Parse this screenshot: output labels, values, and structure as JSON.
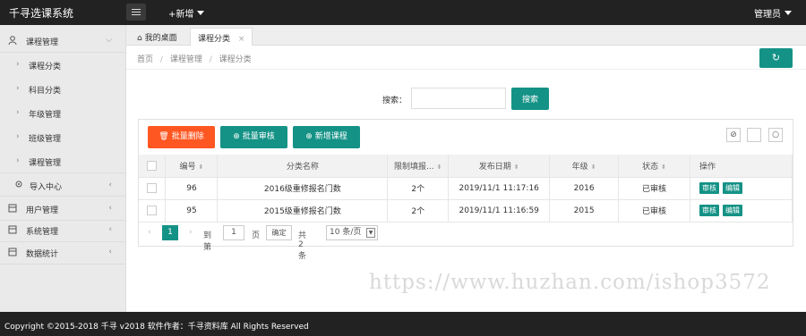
{
  "header": {
    "logo": "千寻选课系统",
    "add_new": "+新增",
    "admin": "管理员"
  },
  "sidebar": {
    "items": [
      {
        "label": "课程管理",
        "icon": "user-icon",
        "expanded": true
      },
      {
        "label": "课程分类"
      },
      {
        "label": "科目分类"
      },
      {
        "label": "年级管理"
      },
      {
        "label": "班级管理"
      },
      {
        "label": "课程管理"
      },
      {
        "label": "导入中心",
        "icon": "location-icon"
      },
      {
        "label": "用户管理",
        "icon": "document-icon"
      },
      {
        "label": "系统管理",
        "icon": "document-icon"
      },
      {
        "label": "数据统计",
        "icon": "document-icon"
      }
    ]
  },
  "tabs": {
    "home": "我的桌面",
    "active": "课程分类",
    "close": "×"
  },
  "breadcrumb": {
    "items": [
      "首页",
      "课程管理",
      "课程分类"
    ],
    "separator": "/"
  },
  "search": {
    "label": "搜索：",
    "value": "",
    "placeholder": "",
    "button": "搜索"
  },
  "toolbar": {
    "batch_delete": "批量删除",
    "batch_audit": "批量审核",
    "add_course": "新增课程"
  },
  "table": {
    "headers": [
      "编号",
      "分类名称",
      "限制填报...",
      "发布日期",
      "年级",
      "状态",
      "操作"
    ],
    "rows": [
      {
        "id": "96",
        "name": "2016级重修报名门数",
        "limit": "2个",
        "date": "2019/11/1 11:17:16",
        "grade": "2016",
        "status": "已审核",
        "op1": "审核",
        "op2": "编辑"
      },
      {
        "id": "95",
        "name": "2015级重修报名门数",
        "limit": "2个",
        "date": "2019/11/1 11:16:59",
        "grade": "2015",
        "status": "已审核",
        "op1": "审核",
        "op2": "编辑"
      }
    ]
  },
  "pager": {
    "current": "1",
    "goto": "到第",
    "input": "1",
    "page": "页",
    "confirm": "确定",
    "total": "共 2 条",
    "size": "10 条/页"
  },
  "watermark": "https://www.huzhan.com/ishop3572",
  "footer": "Copyright ©2015-2018 千寻 v2018 软件作者：千寻资料库 All Rights Reserved",
  "colors": {
    "primary": "#149286",
    "danger": "#ff5722",
    "topbar": "#222222"
  }
}
